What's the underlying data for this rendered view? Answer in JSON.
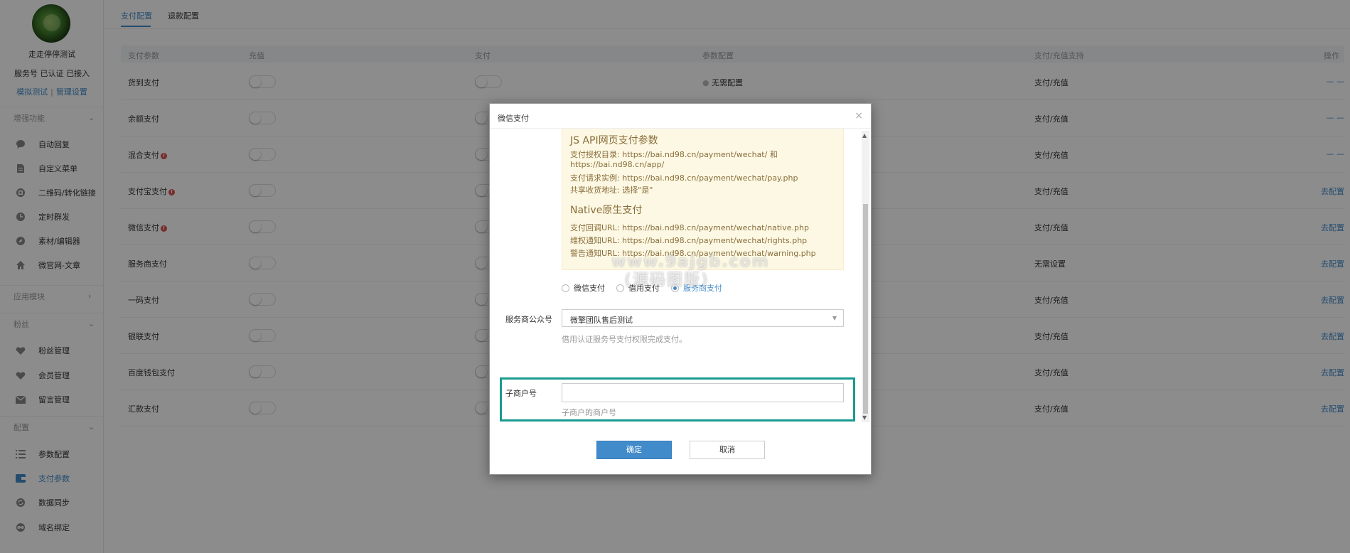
{
  "sidebar": {
    "account_name": "走走停停测试",
    "account_status": "服务号 已认证 已接入",
    "link_simulate": "模拟测试",
    "link_separator": "|",
    "link_manage": "管理设置",
    "groups": {
      "enhance": "增强功能",
      "apps": "应用模块",
      "fans": "粉丝",
      "config": "配置"
    },
    "items": [
      {
        "label": "自动回复",
        "icon": "chat-bubble-icon"
      },
      {
        "label": "自定义菜单",
        "icon": "document-icon"
      },
      {
        "label": "二维码/转化链接",
        "icon": "qrcode-icon"
      },
      {
        "label": "定时群发",
        "icon": "clock-icon"
      },
      {
        "label": "素材/编辑器",
        "icon": "compass-icon"
      },
      {
        "label": "微官网-文章",
        "icon": "home-icon"
      },
      {
        "label": "粉丝管理",
        "icon": "heart-icon"
      },
      {
        "label": "会员管理",
        "icon": "heart-icon"
      },
      {
        "label": "留言管理",
        "icon": "envelope-icon"
      },
      {
        "label": "参数配置",
        "icon": "list-icon"
      },
      {
        "label": "支付参数",
        "icon": "wallet-icon"
      },
      {
        "label": "数据同步",
        "icon": "sync-icon"
      },
      {
        "label": "域名绑定",
        "icon": "link-icon"
      }
    ]
  },
  "tabs": {
    "pay_config": "支付配置",
    "refund_config": "退款配置"
  },
  "table": {
    "headers": {
      "param": "支付参数",
      "recharge": "充值",
      "pay": "支付",
      "config": "参数配置",
      "support": "支付/充值支持",
      "action": "操作"
    },
    "rows": [
      {
        "name": "货到支付",
        "warn": false,
        "config": "无需配置",
        "support": "支付/充值",
        "action": "— —"
      },
      {
        "name": "余额支付",
        "warn": false,
        "config": "",
        "support": "支付/充值",
        "action": "— —"
      },
      {
        "name": "混合支付",
        "warn": true,
        "config": "",
        "support": "支付/充值",
        "action": "— —"
      },
      {
        "name": "支付宝支付",
        "warn": true,
        "config": "",
        "support": "支付/充值",
        "action": "去配置"
      },
      {
        "name": "微信支付",
        "warn": true,
        "config": "",
        "support": "支付/充值",
        "action": "去配置"
      },
      {
        "name": "服务商支付",
        "warn": false,
        "config": "",
        "support": "无需设置",
        "action": "去配置"
      },
      {
        "name": "一码支付",
        "warn": false,
        "config": "",
        "support": "支付/充值",
        "action": "去配置"
      },
      {
        "name": "银联支付",
        "warn": false,
        "config": "",
        "support": "支付/充值",
        "action": "去配置"
      },
      {
        "name": "百度钱包支付",
        "warn": false,
        "config": "",
        "support": "支付/充值",
        "action": "去配置"
      },
      {
        "name": "汇款支付",
        "warn": false,
        "config": "",
        "support": "支付/充值",
        "action": "去配置"
      }
    ]
  },
  "modal": {
    "title": "微信支付",
    "close": "×",
    "info": {
      "jsapi_title": "JS API网页支付参数",
      "jsapi_line1": "支付授权目录: https://bai.nd98.cn/payment/wechat/ 和",
      "jsapi_line1b": "https://bai.nd98.cn/app/",
      "jsapi_line2": "支付请求实例: https://bai.nd98.cn/payment/wechat/pay.php",
      "jsapi_line3": "共享收货地址: 选择\"是\"",
      "native_title": "Native原生支付",
      "native_line1": "支付回调URL: https://bai.nd98.cn/payment/wechat/native.php",
      "native_line2": "维权通知URL: https://bai.nd98.cn/payment/wechat/rights.php",
      "native_line3": "警告通知URL: https://bai.nd98.cn/payment/wechat/warning.php"
    },
    "radios": [
      "微信支付",
      "借用支付",
      "服务商支付"
    ],
    "provider_label": "服务商公众号",
    "provider_value": "微擎团队售后测试",
    "provider_help": "借用认证服务号支付权限完成支付。",
    "sub_merchant_label": "子商户号",
    "sub_merchant_value": "",
    "sub_merchant_help": "子商户的商户号",
    "ok": "确定",
    "cancel": "取消"
  },
  "watermark": {
    "line1": "www.9ajgb.com",
    "line2": "(源码图版)"
  },
  "colors": {
    "accent": "#428bca",
    "highlight_border": "#1a9a8f",
    "info_bg": "#fcf8e3",
    "info_text": "#8a6d3b"
  }
}
